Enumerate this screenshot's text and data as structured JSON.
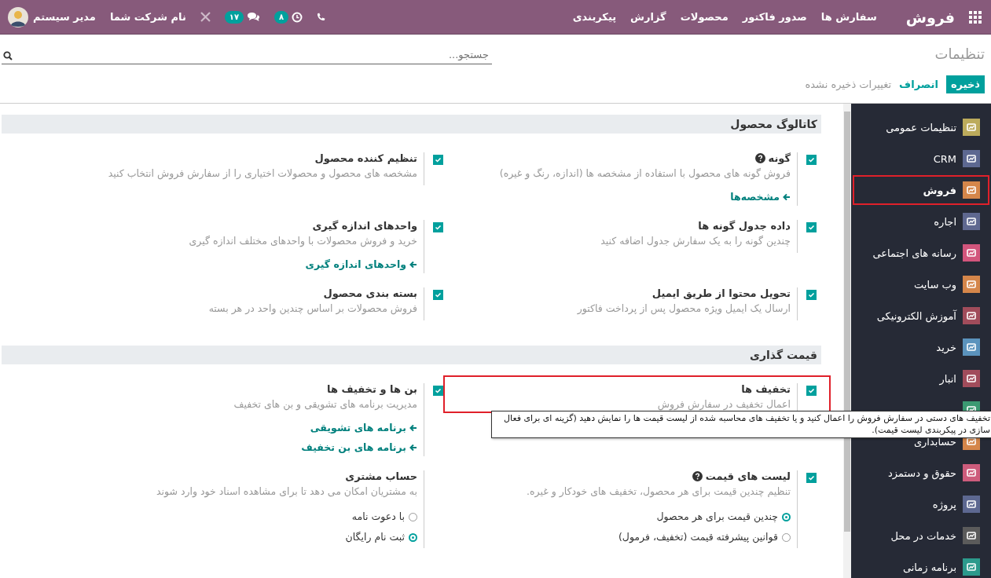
{
  "navbar": {
    "app_name": "فروش",
    "menus": [
      "سفارش ها",
      "صدور فاکتور",
      "محصولات",
      "گزارش",
      "پیکربندی"
    ],
    "activity_count": "۸",
    "message_count": "۱۷",
    "company": "نام شرکت شما",
    "user": "مدیر سیستم"
  },
  "control_panel": {
    "breadcrumb": "تنظیمات",
    "search": {
      "placeholder": "جستجو..."
    },
    "save": "ذخیره",
    "discard": "انصراف",
    "status": "تغییرات ذخیره نشده"
  },
  "sidebar": {
    "items": [
      {
        "label": "تنظیمات عمومی",
        "color": "#bcab5c",
        "selected": false
      },
      {
        "label": "CRM",
        "color": "#5d6891",
        "selected": false
      },
      {
        "label": "فروش",
        "color": "#d5864a",
        "selected": true,
        "highlighted": true
      },
      {
        "label": "اجاره",
        "color": "#5f6890",
        "selected": false
      },
      {
        "label": "رسانه های اجتماعی",
        "color": "#d2557c",
        "selected": false
      },
      {
        "label": "وب سایت",
        "color": "#d5864a",
        "selected": false
      },
      {
        "label": "آموزش الکترونیکی",
        "color": "#a14c5b",
        "selected": false
      },
      {
        "label": "خرید",
        "color": "#5b93bd",
        "selected": false
      },
      {
        "label": "انبار",
        "color": "#a14c5b",
        "selected": false
      },
      {
        "color": "#3b9a72"
      },
      {
        "label": "حسابداری",
        "color": "#d5864a",
        "selected": false
      },
      {
        "label": "حقوق و دستمزد",
        "color": "#cd5c7c",
        "selected": false
      },
      {
        "label": "پروژه",
        "color": "#5d6891",
        "selected": false
      },
      {
        "label": "خدمات در محل",
        "color": "#5b5b5b",
        "selected": false
      },
      {
        "label": "برنامه زمانی",
        "color": "#2c9a8c",
        "selected": false
      }
    ]
  },
  "sections": [
    {
      "title": "کاتالوگ محصول",
      "settings": [
        {
          "kind": "checkbox",
          "checked": true,
          "title": "گونه",
          "help": true,
          "description": "فروش گونه های محصول با استفاده از مشخصه ها (اندازه، رنگ و غیره)",
          "links": [
            "مشخصه‌ها"
          ]
        },
        {
          "kind": "checkbox",
          "checked": true,
          "title": "تنظیم کننده محصول",
          "description": "مشخصه های محصول و محصولات اختیاری را از سفارش فروش انتخاب کنید"
        },
        {
          "kind": "checkbox",
          "checked": true,
          "title": "داده جدول گونه ها",
          "description": "چندین گونه را به یک سفارش جدول اضافه کنید"
        },
        {
          "kind": "checkbox",
          "checked": true,
          "title": "واحدهای اندازه گیری",
          "description": "خرید و فروش محصولات با واحدهای مختلف اندازه گیری",
          "links": [
            "واحدهای اندازه گیری"
          ]
        },
        {
          "kind": "checkbox",
          "checked": true,
          "title": "تحویل محتوا از طریق ایمیل",
          "description": "ارسال یک ایمیل ویژه محصول پس از پرداخت فاکتور"
        },
        {
          "kind": "checkbox",
          "checked": true,
          "title": "بسته بندی محصول",
          "description": "فروش محصولات بر اساس چندین واحد در هر بسته"
        }
      ]
    },
    {
      "title": "قیمت گذاری",
      "settings": [
        {
          "kind": "checkbox",
          "checked": true,
          "title": "تخفیف ها",
          "description": "اعمال تخفیف در سفارش فروش",
          "highlighted": true
        },
        {
          "kind": "checkbox",
          "checked": true,
          "title": "بن ها و تخفیف ها",
          "description": "مدیریت برنامه های تشویقی و بن های تخفیف",
          "links": [
            "برنامه های تشویقی",
            "برنامه های بن تخفیف"
          ]
        },
        {
          "kind": "checkbox",
          "checked": true,
          "title": "لیست های قیمت",
          "help": true,
          "description": "تنظیم چندین قیمت برای هر محصول، تخفیف های خودکار و غیره.",
          "options": [
            {
              "label": "چندین قیمت برای هر محصول",
              "selected": true
            },
            {
              "label": "قوانین پیشرفته قیمت (تخفیف، فرمول)",
              "selected": false
            }
          ]
        },
        {
          "kind": "plain",
          "title": "حساب مشتری",
          "description": "به مشتریان امکان می دهد تا برای مشاهده اسناد خود وارد شوند",
          "options": [
            {
              "label": "با دعوت نامه",
              "selected": false
            },
            {
              "label": "ثبت نام رایگان",
              "selected": true
            }
          ]
        }
      ]
    }
  ],
  "tooltip": {
    "text": "تخفیف های دستی در سفارش فروش را اعمال کنید و یا تخفیف های محاسبه شده از لیست قیمت ها را نمایش دهید (گزینه ای برای فعال سازی در پیکربندی لیست قیمت)."
  }
}
